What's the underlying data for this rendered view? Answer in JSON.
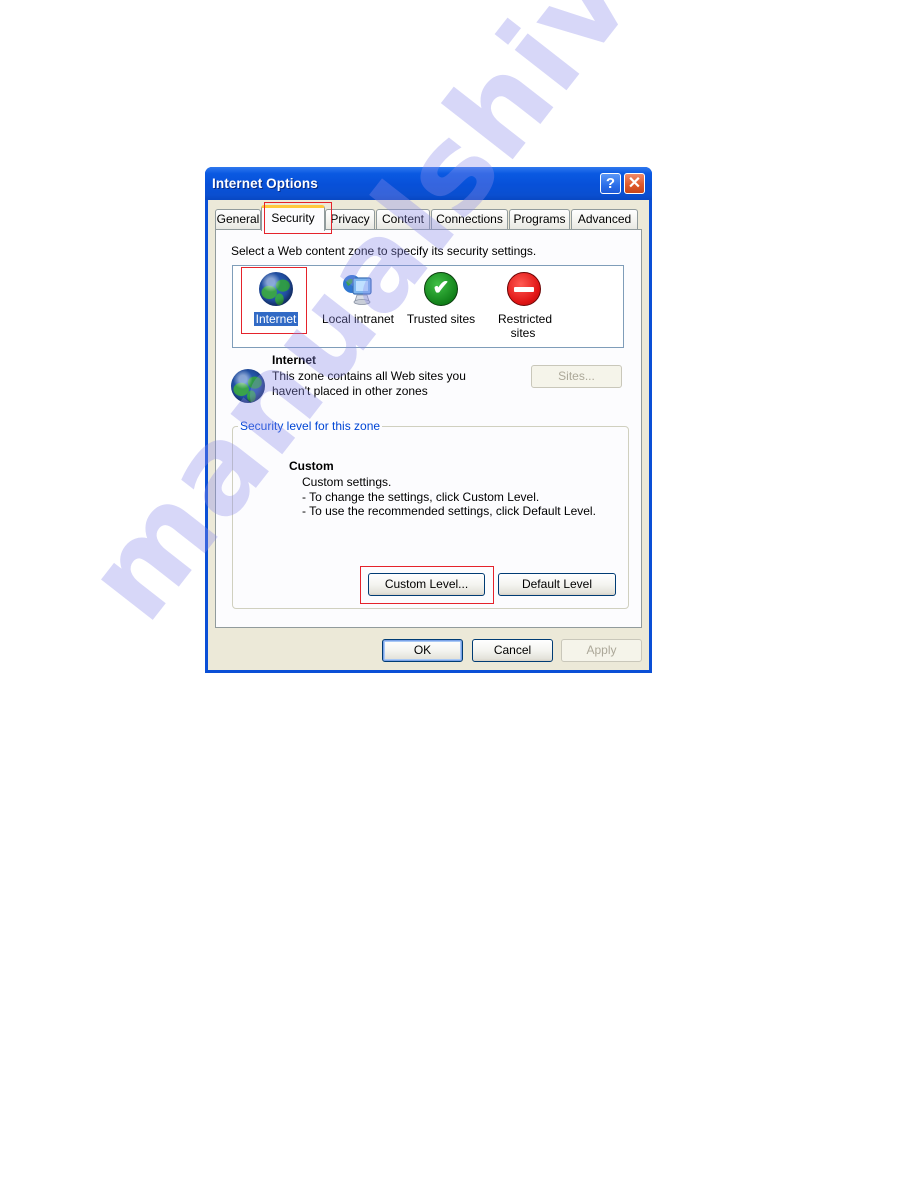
{
  "window": {
    "title": "Internet Options",
    "help_label": "?",
    "close_label": "✕"
  },
  "tabs": [
    {
      "label": "General",
      "active": false
    },
    {
      "label": "Security",
      "active": true
    },
    {
      "label": "Privacy",
      "active": false
    },
    {
      "label": "Content",
      "active": false
    },
    {
      "label": "Connections",
      "active": false
    },
    {
      "label": "Programs",
      "active": false
    },
    {
      "label": "Advanced",
      "active": false
    }
  ],
  "security": {
    "instruction": "Select a Web content zone to specify its security settings.",
    "zones": [
      {
        "label": "Internet",
        "icon": "globe-icon",
        "selected": true
      },
      {
        "label": "Local intranet",
        "icon": "intranet-computer-icon",
        "selected": false
      },
      {
        "label": "Trusted sites",
        "icon": "green-checkmark-icon",
        "selected": false
      },
      {
        "label": "Restricted sites",
        "icon": "red-no-entry-icon",
        "selected": false
      }
    ],
    "selected_zone": {
      "name": "Internet",
      "description_line1": "This zone contains all Web sites you",
      "description_line2": "haven't placed in other zones",
      "icon": "globe-icon"
    },
    "sites_button": "Sites...",
    "sites_enabled": false,
    "level_group_title": "Security level for this zone",
    "level_name": "Custom",
    "level_desc": [
      "Custom settings.",
      "- To change the settings, click Custom Level.",
      "- To use the recommended settings, click Default Level."
    ],
    "custom_level_button": "Custom Level...",
    "default_level_button": "Default Level"
  },
  "footer": {
    "ok": "OK",
    "cancel": "Cancel",
    "apply": "Apply",
    "apply_enabled": false
  },
  "annotations": {
    "highlight_color": "#e5232b",
    "highlighted": [
      "tab-security",
      "zone-internet",
      "custom-level-button"
    ]
  },
  "watermark": "manualshive.com"
}
